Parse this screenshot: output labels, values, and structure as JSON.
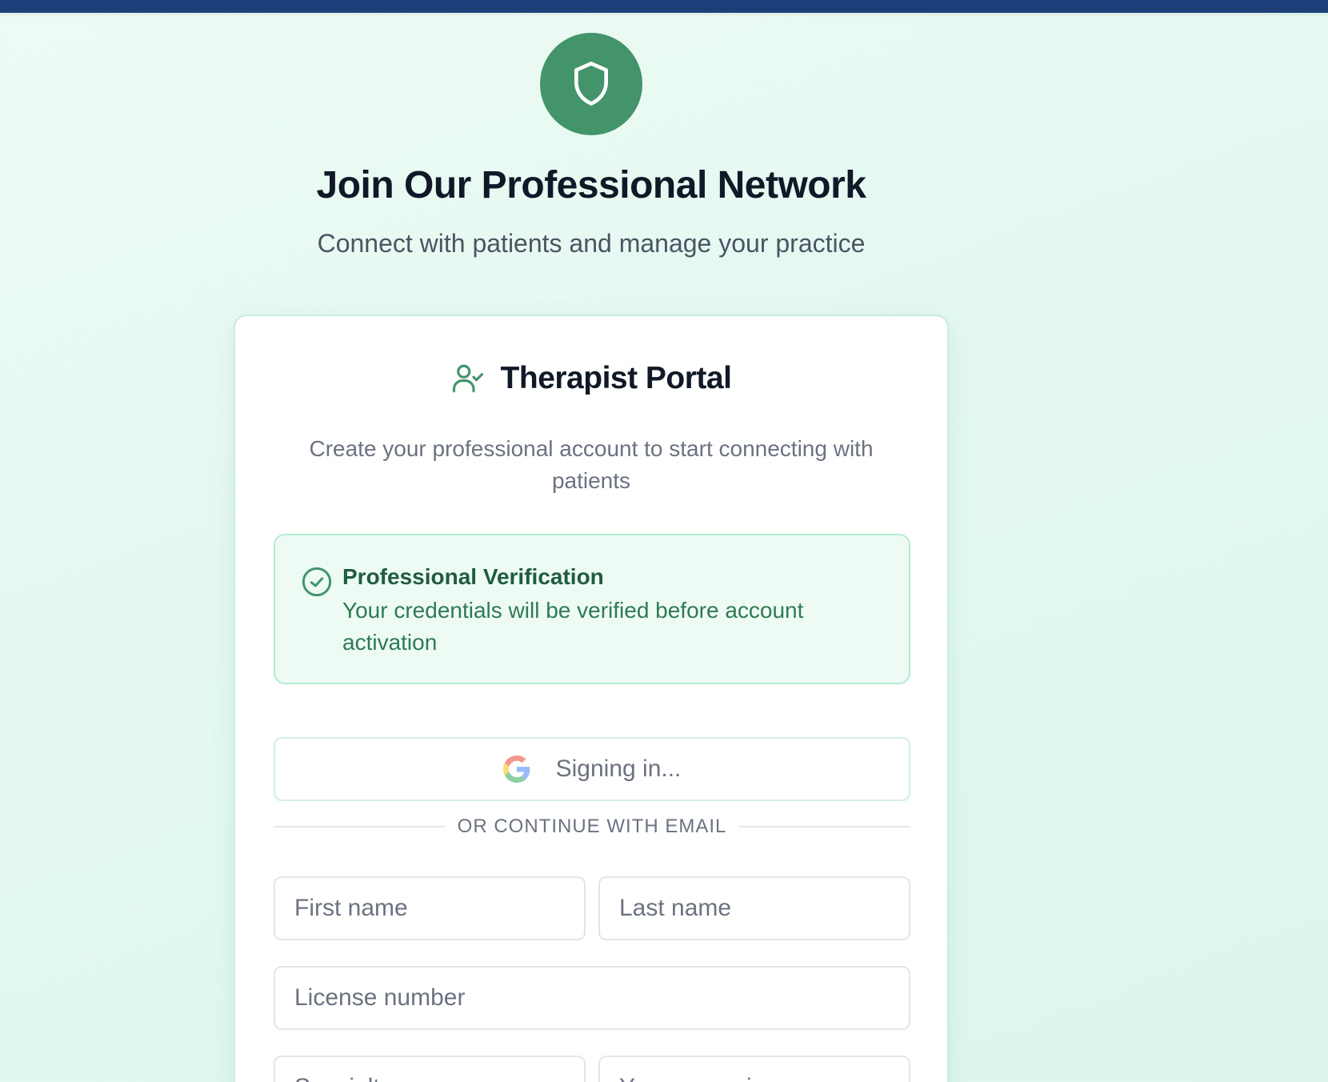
{
  "header": {
    "title": "Join Our Professional Network",
    "subtitle": "Connect with patients and manage your practice",
    "logo_icon": "shield-icon",
    "accent_color": "#43946b",
    "top_bar_color": "#1c3f7a"
  },
  "card": {
    "title": "Therapist Portal",
    "title_icon": "user-check-icon",
    "description": "Create your professional account to start connecting with patients",
    "notice": {
      "icon": "check-circle-icon",
      "title": "Professional Verification",
      "text": "Your credentials will be verified before account activation"
    },
    "google_button": {
      "icon": "google-icon",
      "label": "Signing in..."
    },
    "divider_label": "OR CONTINUE WITH EMAIL",
    "fields": {
      "first_name": {
        "placeholder": "First name",
        "value": ""
      },
      "last_name": {
        "placeholder": "Last name",
        "value": ""
      },
      "license_number": {
        "placeholder": "License number",
        "value": ""
      },
      "specialty": {
        "placeholder": "Specialty",
        "value": ""
      },
      "years_experience": {
        "placeholder": "Years experience",
        "value": ""
      }
    }
  }
}
